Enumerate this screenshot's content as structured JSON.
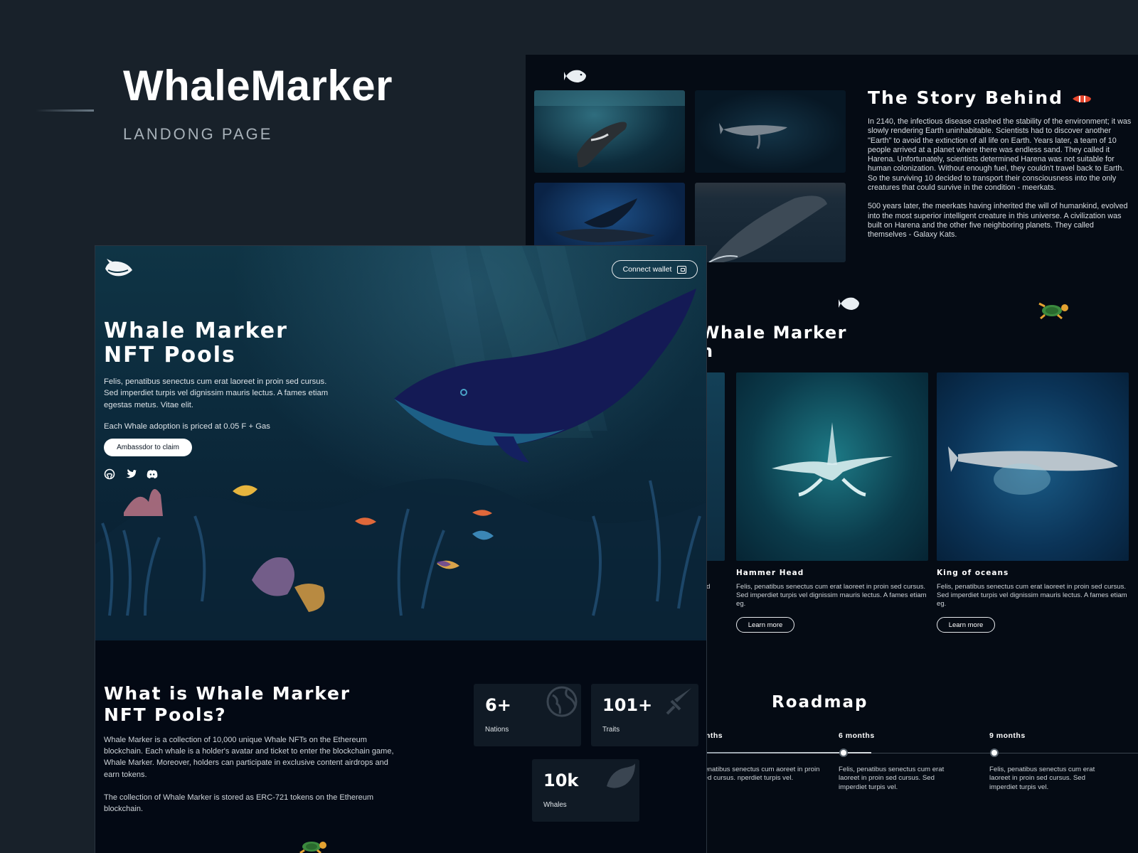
{
  "showcase": {
    "title": "WhaleMarker",
    "subtitle": "LANDONG PAGE"
  },
  "story": {
    "title": "The Story Behind",
    "paragraphs": [
      "In 2140, the infectious disease crashed the stability of the environment; it was slowly rendering Earth uninhabitable. Scientists had to discover another \"Earth\" to avoid the extinction of all life on Earth. Years later, a team of 10 people arrived at a planet where there was endless sand. They called it Harena. Unfortunately, scientists determined Harena was not suitable for human colonization. Without enough fuel, they couldn't travel back to Earth. So the surviving 10 decided to transport their consciousness into the only creatures that could survive in the condition - meerkats.",
      "500 years later, the meerkats having inherited the will of humankind, evolved into the most superior intelligent creature in this universe. A civilization was built on Harena and the other five neighboring planets. They called themselves - Galaxy Kats."
    ]
  },
  "collection": {
    "title_line1": "Whale Marker",
    "title_line2": "n",
    "partial_card_desc": "n sed",
    "cards": [
      {
        "name": "Hammer Head",
        "desc": "Felis, penatibus senectus cum erat laoreet in proin sed cursus. Sed imperdiet turpis vel dignissim mauris lectus. A fames etiam eg.",
        "button": "Learn more"
      },
      {
        "name": "King of oceans",
        "desc": "Felis, penatibus senectus cum erat laoreet in proin sed cursus. Sed imperdiet turpis vel dignissim mauris lectus. A fames etiam eg.",
        "button": "Learn more"
      },
      {
        "button": "Learn more"
      }
    ]
  },
  "roadmap": {
    "title": "Roadmap",
    "milestones": [
      {
        "label": "onths",
        "desc": "penatibus senectus cum aoreet in proin sed cursus. nperdiet turpis vel."
      },
      {
        "label": "6 months",
        "desc": "Felis, penatibus senectus cum erat laoreet in proin sed cursus. Sed imperdiet turpis vel."
      },
      {
        "label": "9 months",
        "desc": "Felis, penatibus senectus cum erat laoreet in proin sed cursus. Sed imperdiet turpis vel."
      }
    ]
  },
  "hero": {
    "connect_label": "Connect wallet",
    "title_line1": "Whale Marker",
    "title_line2": "NFT Pools",
    "description": "Felis, penatibus senectus cum erat laoreet in proin sed cursus. Sed imperdiet turpis vel dignissim mauris lectus. A fames etiam egestas metus. Vitae elit.",
    "price": "Each Whale adoption is priced at 0.05 F + Gas",
    "claim_label": "Ambassdor to claim",
    "socials": [
      "github-icon",
      "twitter-icon",
      "discord-icon"
    ]
  },
  "about": {
    "title_line1": "What is Whale Marker",
    "title_line2": "NFT Pools?",
    "paragraphs": [
      "Whale Marker is a collection of 10,000 unique Whale NFTs on the Ethereum blockchain. Each whale is a holder's avatar and ticket to enter the blockchain game, Whale Marker. Moreover, holders can participate in exclusive content airdrops and earn tokens.",
      "The collection of Whale Marker is stored as ERC-721 tokens on the Ethereum blockchain."
    ]
  },
  "stats": [
    {
      "value": "6+",
      "label": "Nations",
      "icon": "globe-icon"
    },
    {
      "value": "101+",
      "label": "Traits",
      "icon": "sword-icon"
    },
    {
      "value": "10k",
      "label": "Whales",
      "icon": "whale-icon"
    }
  ],
  "colors": {
    "background": "#18212a",
    "panel": "#050b14",
    "hero_deep": "#0c2b3d",
    "whale_body": "#141a55",
    "stat_card": "#101a25"
  }
}
